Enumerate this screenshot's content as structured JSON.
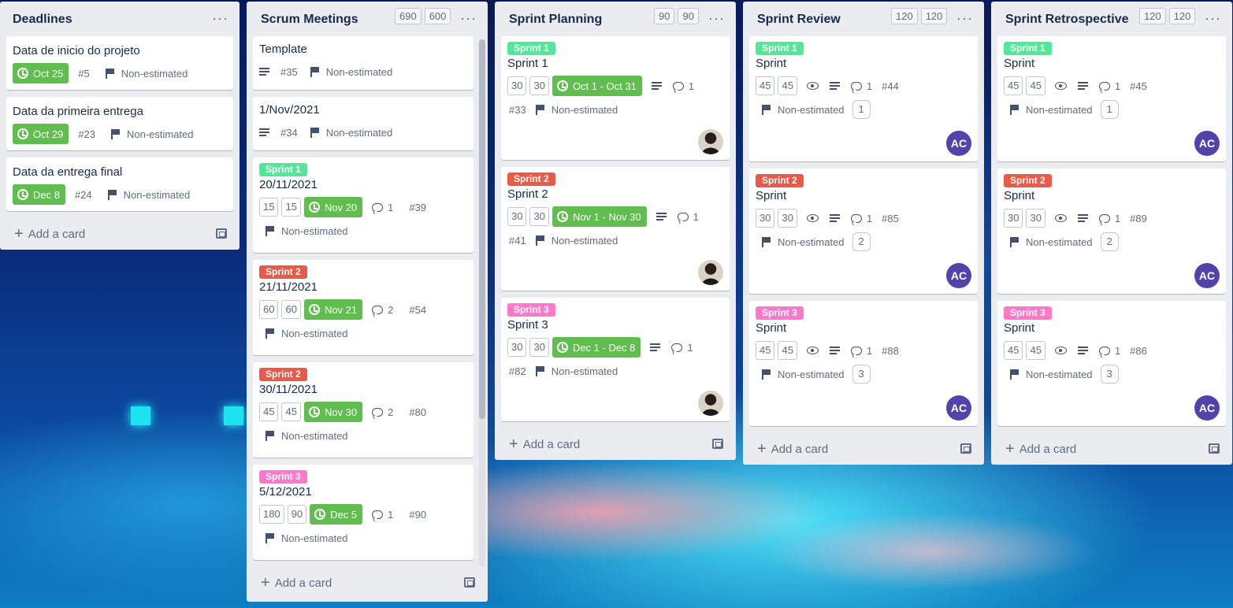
{
  "colors": {
    "label_sprint1": "#51e898",
    "label_sprint2": "#eb5a46",
    "label_sprint3": "#ff78cb",
    "due_green": "#61bd4f",
    "avatar_purple": "#5243aa"
  },
  "ui": {
    "add_card": "Add a card",
    "non_estimated": "Non-estimated",
    "list_menu": "···"
  },
  "lists": [
    {
      "title": "Deadlines",
      "cards": [
        {
          "title": "Data de inicio do projeto",
          "due": "Oct 25",
          "id": "#5"
        },
        {
          "title": "Data da primeira entrega",
          "due": "Oct 29",
          "id": "#23"
        },
        {
          "title": "Data da entrega final",
          "due": "Dec 8",
          "id": "#24"
        }
      ]
    },
    {
      "title": "Scrum Meetings",
      "points": [
        "690",
        "600"
      ],
      "cards": [
        {
          "title": "Template",
          "id": "#35"
        },
        {
          "title": "1/Nov/2021",
          "id": "#34"
        },
        {
          "label": "Sprint 1",
          "title": "20/11/2021",
          "pts": [
            "15",
            "15"
          ],
          "due": "Nov 20",
          "comments": "1",
          "id": "#39"
        },
        {
          "label": "Sprint 2",
          "title": "21/11/2021",
          "pts": [
            "60",
            "60"
          ],
          "due": "Nov 21",
          "comments": "2",
          "id": "#54"
        },
        {
          "label": "Sprint 2",
          "title": "30/11/2021",
          "pts": [
            "45",
            "45"
          ],
          "due": "Nov 30",
          "comments": "2",
          "id": "#80"
        },
        {
          "label": "Sprint 3",
          "title": "5/12/2021",
          "pts": [
            "180",
            "90"
          ],
          "due": "Dec 5",
          "comments": "1",
          "id": "#90"
        }
      ]
    },
    {
      "title": "Sprint Planning",
      "points": [
        "90",
        "90"
      ],
      "cards": [
        {
          "label": "Sprint 1",
          "title": "Sprint 1",
          "pts": [
            "30",
            "30"
          ],
          "due": "Oct 1 - Oct 31",
          "comments": "1",
          "id": "#33"
        },
        {
          "label": "Sprint 2",
          "title": "Sprint 2",
          "pts": [
            "30",
            "30"
          ],
          "due": "Nov 1 - Nov 30",
          "comments": "1",
          "id": "#41"
        },
        {
          "label": "Sprint 3",
          "title": "Sprint 3",
          "pts": [
            "30",
            "30"
          ],
          "due": "Dec 1 - Dec 8",
          "comments": "1",
          "id": "#82"
        }
      ]
    },
    {
      "title": "Sprint Review",
      "points": [
        "120",
        "120"
      ],
      "cards": [
        {
          "label": "Sprint 1",
          "title": "Sprint",
          "pts": [
            "45",
            "45"
          ],
          "comments": "1",
          "id": "#44",
          "count": "1",
          "avatar": "AC"
        },
        {
          "label": "Sprint 2",
          "title": "Sprint",
          "pts": [
            "30",
            "30"
          ],
          "comments": "1",
          "id": "#85",
          "count": "2",
          "avatar": "AC"
        },
        {
          "label": "Sprint 3",
          "title": "Sprint",
          "pts": [
            "45",
            "45"
          ],
          "comments": "1",
          "id": "#88",
          "count": "3",
          "avatar": "AC"
        }
      ]
    },
    {
      "title": "Sprint Retrospective",
      "points": [
        "120",
        "120"
      ],
      "cards": [
        {
          "label": "Sprint 1",
          "title": "Sprint",
          "pts": [
            "45",
            "45"
          ],
          "comments": "1",
          "id": "#45",
          "count": "1",
          "avatar": "AC"
        },
        {
          "label": "Sprint 2",
          "title": "Sprint",
          "pts": [
            "30",
            "30"
          ],
          "comments": "1",
          "id": "#89",
          "count": "2",
          "avatar": "AC"
        },
        {
          "label": "Sprint 3",
          "title": "Sprint",
          "pts": [
            "45",
            "45"
          ],
          "comments": "1",
          "id": "#86",
          "count": "3",
          "avatar": "AC"
        }
      ]
    }
  ]
}
